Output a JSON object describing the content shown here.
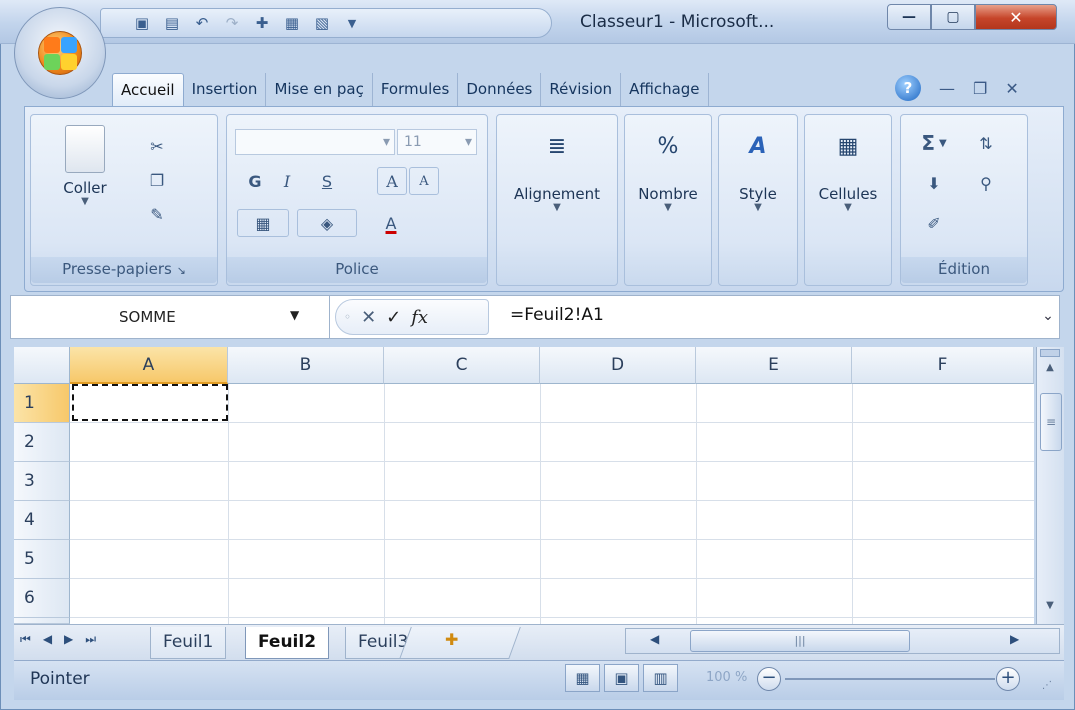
{
  "window": {
    "title": "Classeur1 - Microsoft...",
    "minimize": "—",
    "maximize": "▢",
    "close": "✕"
  },
  "quick_access": [
    "save",
    "print",
    "undo",
    "redo",
    "insert-table",
    "chart",
    "preview"
  ],
  "ribbon": {
    "tabs": [
      "Accueil",
      "Insertion",
      "Mise en paç",
      "Formules",
      "Données",
      "Révision",
      "Affichage"
    ],
    "active_tab": "Accueil",
    "help": "?",
    "groups": {
      "clipboard": {
        "label": "Presse-papiers",
        "paste": "Coller"
      },
      "font": {
        "label": "Police",
        "size": "11",
        "bold": "G",
        "italic": "I",
        "underline": "S",
        "grow": "A",
        "shrink": "A",
        "color": "A"
      },
      "alignment": {
        "label": "Alignement"
      },
      "number": {
        "label": "Nombre",
        "percent": "%"
      },
      "style": {
        "label": "Style"
      },
      "cells": {
        "label": "Cellules"
      },
      "editing": {
        "label": "Édition",
        "sum": "Σ"
      }
    }
  },
  "formula_bar": {
    "name_box": "SOMME",
    "fx": "fx",
    "cancel": "✕",
    "enter": "✓",
    "formula": "=Feuil2!A1"
  },
  "grid": {
    "columns": [
      "A",
      "B",
      "C",
      "D",
      "E",
      "F"
    ],
    "rows": [
      "1",
      "2",
      "3",
      "4",
      "5",
      "6"
    ]
  },
  "sheets": {
    "tabs": [
      "Feuil1",
      "Feuil2",
      "Feuil3"
    ],
    "active": "Feuil2"
  },
  "status": {
    "mode": "Pointer",
    "zoom": "100 %",
    "zoom_minus": "−",
    "zoom_plus": "+"
  }
}
